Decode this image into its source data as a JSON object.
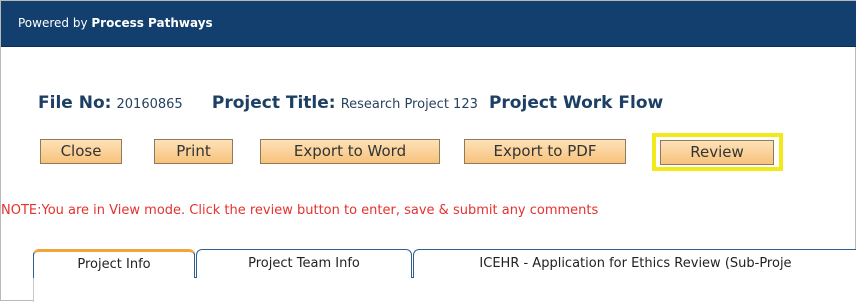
{
  "header": {
    "powered_prefix": "Powered by ",
    "powered_brand": "Process Pathways"
  },
  "file": {
    "file_no_label": "File No:",
    "file_no_value": "20160865",
    "project_title_label": "Project Title:",
    "project_title_value": "Research Project 123",
    "workflow_label": "Project Work Flow"
  },
  "toolbar": {
    "close_label": "Close",
    "print_label": "Print",
    "export_word_label": "Export to Word",
    "export_pdf_label": "Export to PDF",
    "review_label": "Review"
  },
  "note": "NOTE:You are in View mode. Click the review button to enter, save & submit any comments",
  "tabs": [
    {
      "label": "Project Info",
      "active": true
    },
    {
      "label": "Project Team Info",
      "active": false
    },
    {
      "label": "ICEHR - Application for Ethics Review (Sub-Proje",
      "active": false
    }
  ],
  "colors": {
    "header_bg": "#123f6e",
    "title_text": "#1c3f63",
    "button_bg": "#f7c27c",
    "highlight": "#f2ea18",
    "note_text": "#e4322e",
    "tab_active_accent": "#f0a43a"
  }
}
